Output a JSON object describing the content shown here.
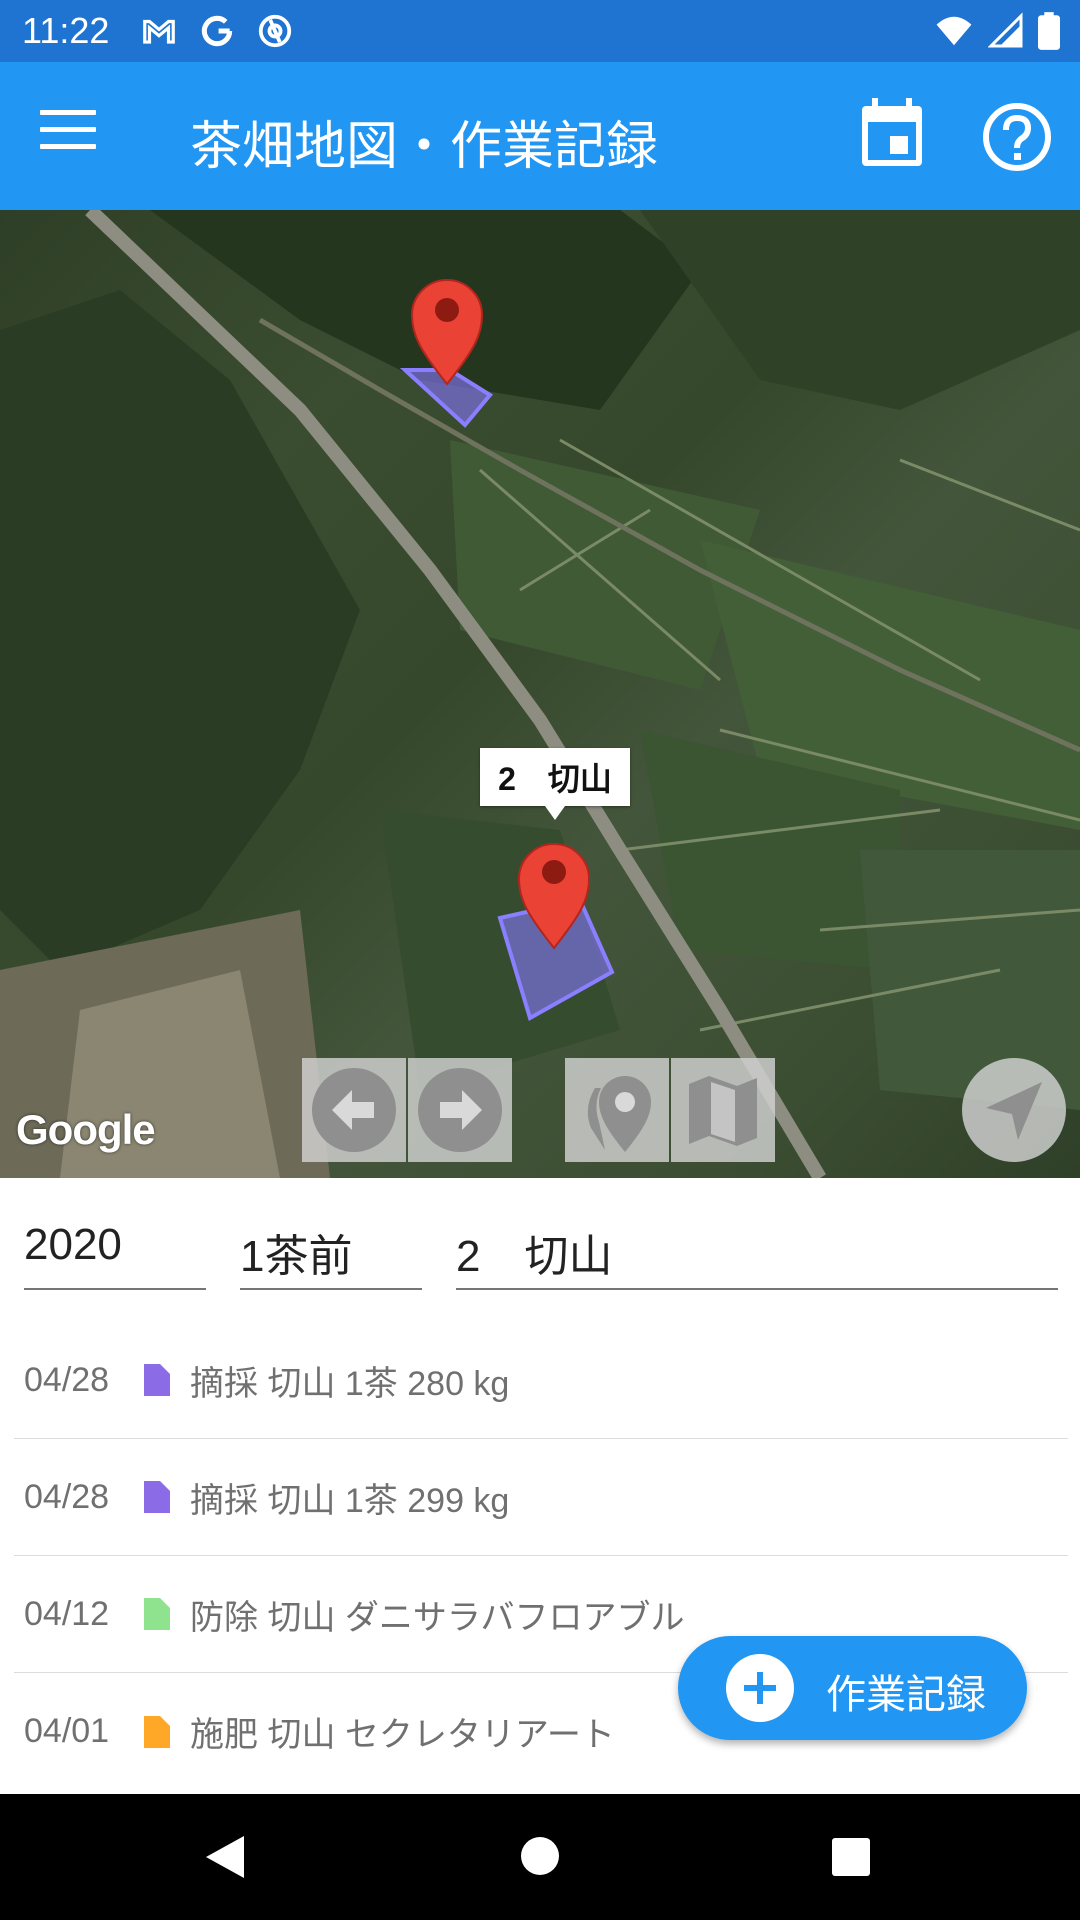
{
  "status_bar": {
    "time": "11:22",
    "left_icons": [
      "gmail-icon",
      "google-icon",
      "at-icon"
    ],
    "right_icons": [
      "wifi-icon",
      "signal-icon",
      "battery-icon"
    ]
  },
  "app_bar": {
    "title": "茶畑地図・作業記録",
    "actions": [
      "menu-icon",
      "calendar-icon",
      "help-icon"
    ]
  },
  "map": {
    "marker_label": "2　切山",
    "attribution": "Google",
    "controls": [
      "prev-icon",
      "next-icon",
      "marker-toggle-icon",
      "map-layer-icon",
      "my-location-icon"
    ],
    "colors": {
      "polygon": "#7b6fe0",
      "marker": "#ea4335"
    }
  },
  "filters": {
    "year": "2020",
    "season": "1茶前",
    "field": "2　切山"
  },
  "records": [
    {
      "date": "04/28",
      "icon": "document-icon",
      "color": "#8c6be6",
      "text": "摘採  切山  1茶 280 kg"
    },
    {
      "date": "04/28",
      "icon": "document-icon",
      "color": "#8c6be6",
      "text": "摘採  切山  1茶 299 kg"
    },
    {
      "date": "04/12",
      "icon": "document-icon",
      "color": "#8fe38f",
      "text": "防除  切山  ダニサラバフロアブル"
    },
    {
      "date": "04/01",
      "icon": "document-icon",
      "color": "#ffa726",
      "text": "施肥  切山  セクレタリアート"
    }
  ],
  "fab": {
    "label": "作業記録",
    "icon": "plus-icon"
  },
  "nav_bar": {
    "buttons": [
      "back-icon",
      "home-icon",
      "recents-icon"
    ]
  }
}
